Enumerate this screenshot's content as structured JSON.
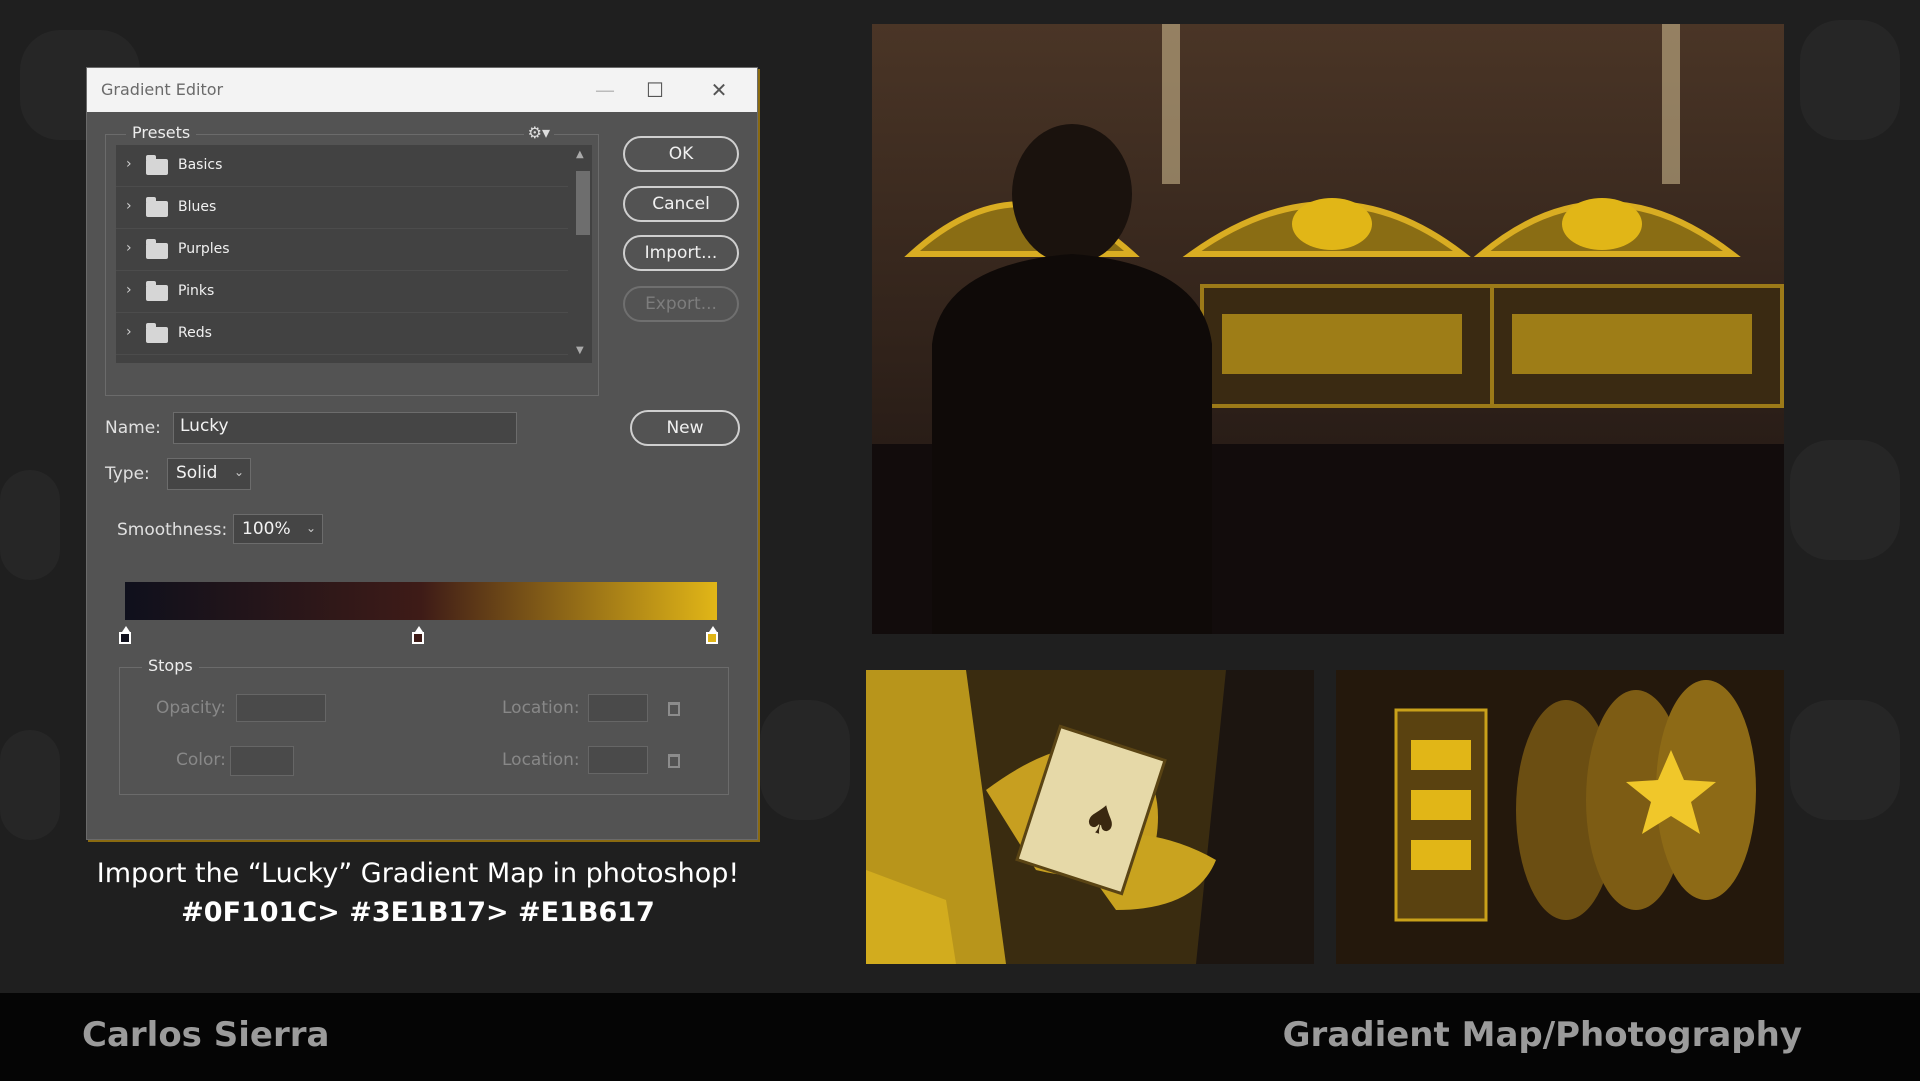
{
  "dialog": {
    "title": "Gradient Editor",
    "window_buttons": {
      "minimize": "—",
      "maximize": "☐",
      "close": "✕"
    },
    "presets": {
      "label": "Presets",
      "gear_icon": "⚙▾",
      "items": [
        {
          "label": "Basics"
        },
        {
          "label": "Blues"
        },
        {
          "label": "Purples"
        },
        {
          "label": "Pinks"
        },
        {
          "label": "Reds"
        }
      ]
    },
    "buttons": {
      "ok": "OK",
      "cancel": "Cancel",
      "import": "Import...",
      "export": "Export...",
      "new": "New"
    },
    "name_label": "Name:",
    "name_value": "Lucky",
    "type_label": "Type:",
    "type_value": "Solid",
    "smoothness_label": "Smoothness:",
    "smoothness_value": "100%",
    "gradient_stops": [
      {
        "color": "#0f101c",
        "location": 0
      },
      {
        "color": "#3e1b17",
        "location": 0.5
      },
      {
        "color": "#e1b617",
        "location": 1
      }
    ],
    "stops_group": {
      "label": "Stops",
      "opacity_label": "Opacity:",
      "location_label": "Location:",
      "color_label": "Color:",
      "location_label_2": "Location:"
    }
  },
  "caption": {
    "line1": "Import the “Lucky” Gradient Map in photoshop!",
    "line2": "#0F101C> #3E1B17> #E1B617"
  },
  "footer": {
    "author": "Carlos Sierra",
    "category": "Gradient Map/Photography"
  },
  "colors": {
    "accent_gold": "#e1b617",
    "dark_navy": "#0f101c",
    "deep_brown": "#3e1b17"
  }
}
